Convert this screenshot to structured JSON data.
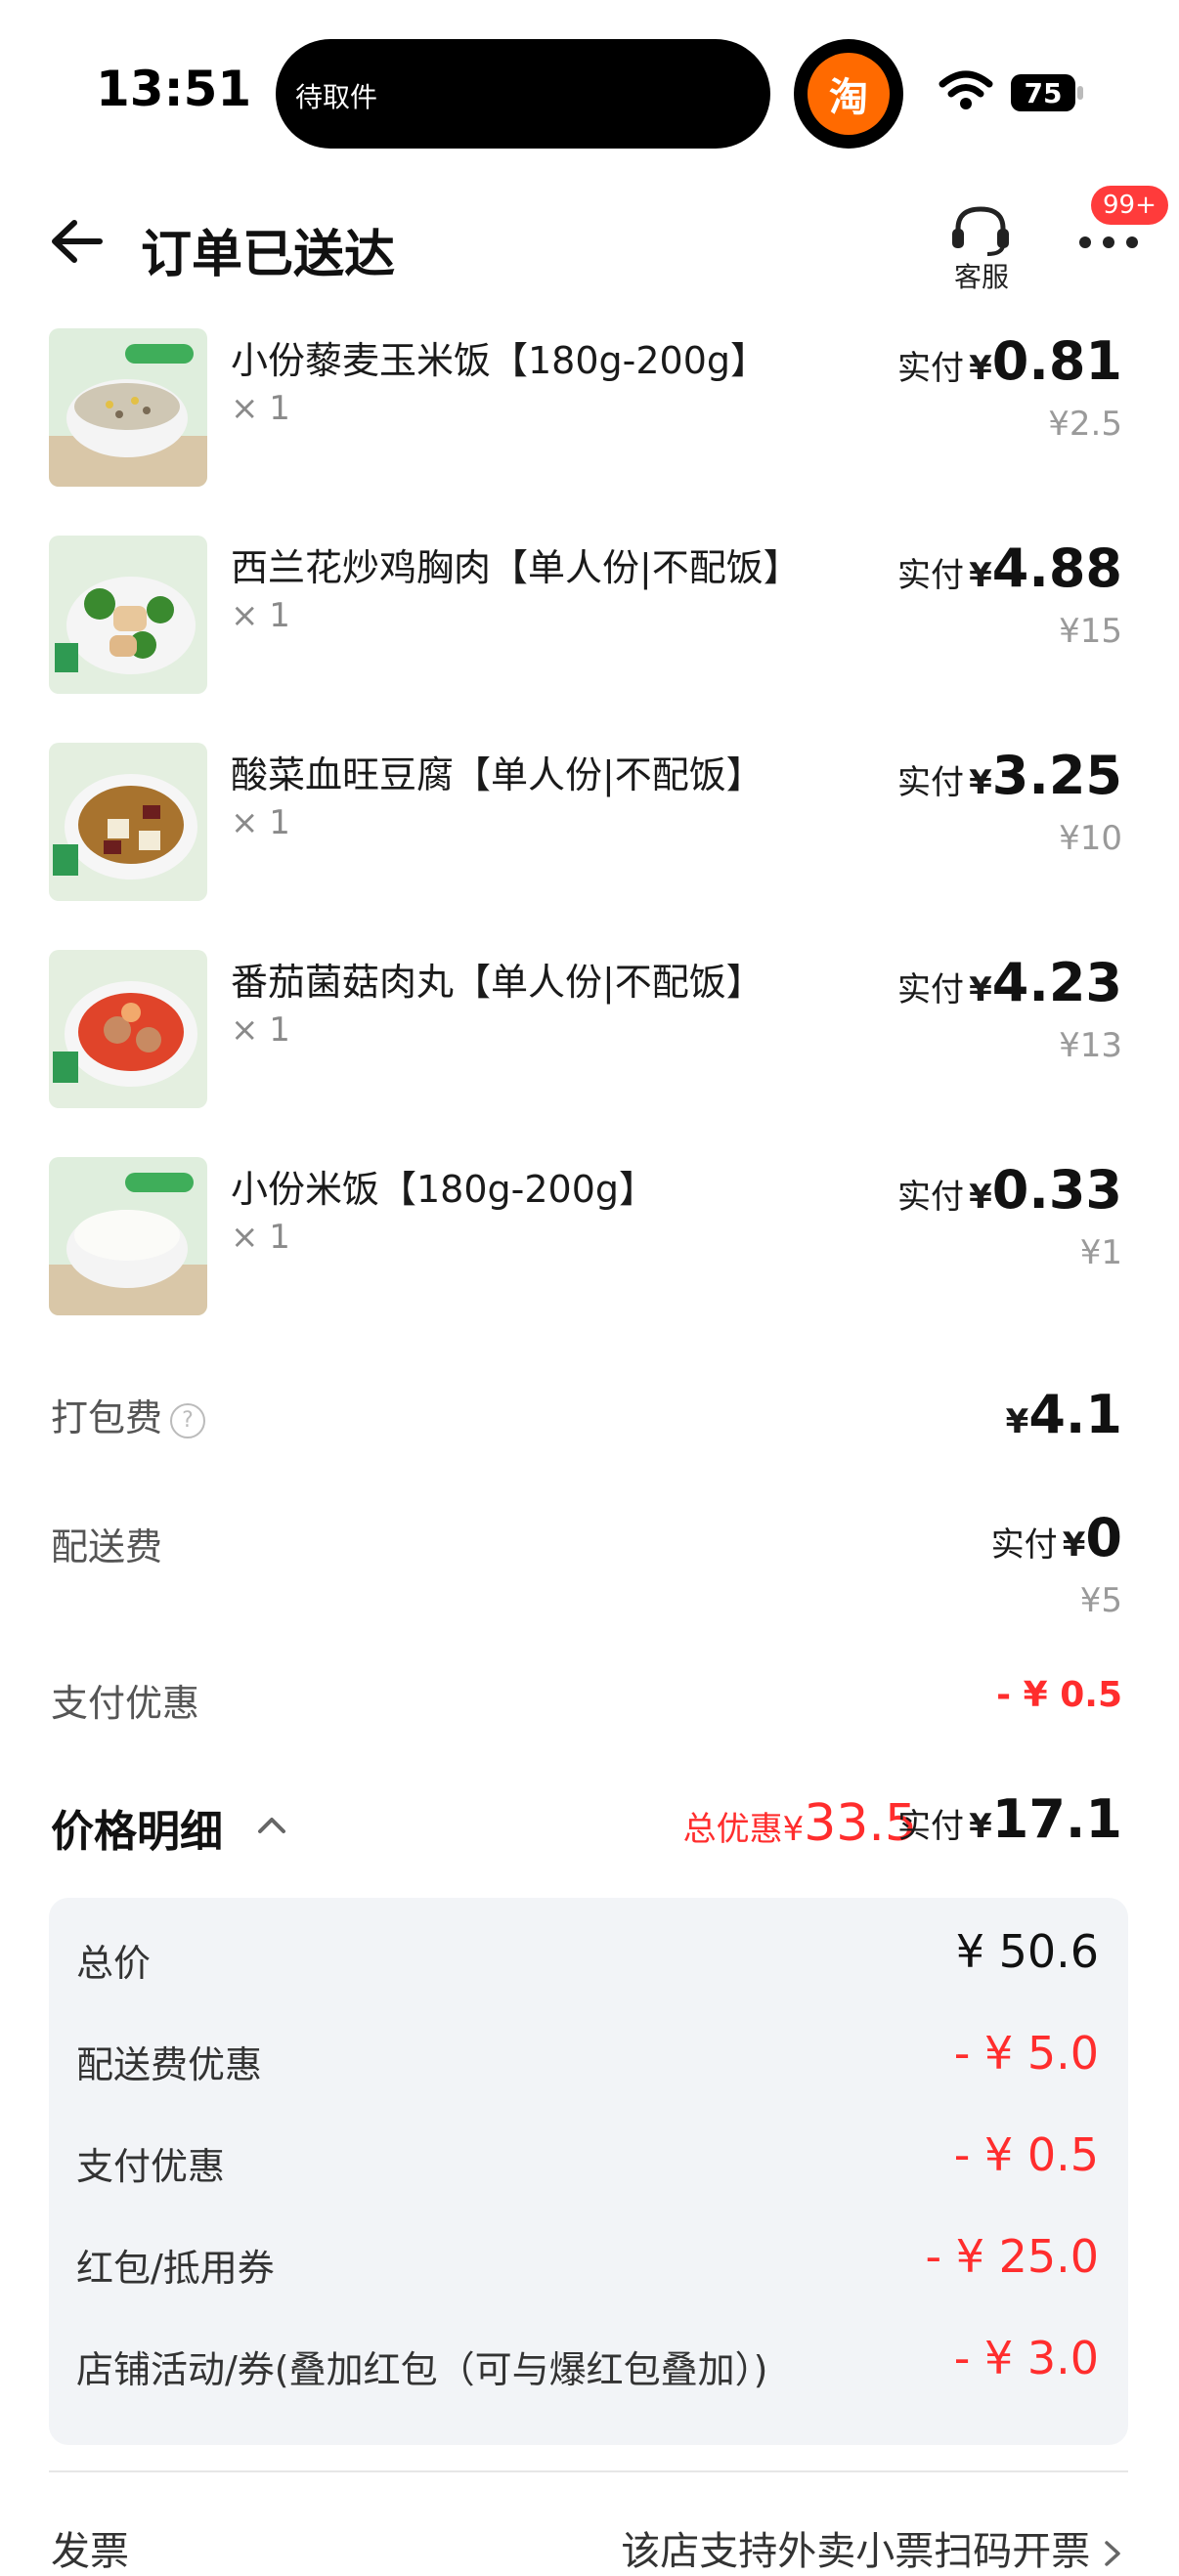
{
  "status_bar": {
    "time": "13:51",
    "island_text": "待取件",
    "app_icon_char": "淘",
    "battery": "75"
  },
  "header": {
    "title": "订单已送达",
    "service_label": "客服",
    "badge": "99+"
  },
  "items": [
    {
      "name": "小份藜麦玉米饭【180g-200g】",
      "qty": "× 1",
      "paid_label": "实付",
      "currency": "¥",
      "paid": "0.81",
      "original": "¥2.5",
      "thumb": "rice-grain"
    },
    {
      "name": "西兰花炒鸡胸肉【单人份|不配饭】",
      "qty": "× 1",
      "paid_label": "实付",
      "currency": "¥",
      "paid": "4.88",
      "original": "¥15",
      "thumb": "broccoli-chicken"
    },
    {
      "name": "酸菜血旺豆腐【单人份|不配饭】",
      "qty": "× 1",
      "paid_label": "实付",
      "currency": "¥",
      "paid": "3.25",
      "original": "¥10",
      "thumb": "tofu-soup"
    },
    {
      "name": "番茄菌菇肉丸【单人份|不配饭】",
      "qty": "× 1",
      "paid_label": "实付",
      "currency": "¥",
      "paid": "4.23",
      "original": "¥13",
      "thumb": "tomato-meatball"
    },
    {
      "name": "小份米饭【180g-200g】",
      "qty": "× 1",
      "paid_label": "实付",
      "currency": "¥",
      "paid": "0.33",
      "original": "¥1",
      "thumb": "white-rice"
    }
  ],
  "fees": {
    "packing_label": "打包费",
    "packing_help": "?",
    "packing_currency": "¥",
    "packing_value": "4.1",
    "delivery_label": "配送费",
    "delivery_paid_label": "实付",
    "delivery_currency": "¥",
    "delivery_value": "0",
    "delivery_original": "¥5",
    "pay_discount_label": "支付优惠",
    "pay_discount_value": "- ¥ 0.5"
  },
  "price_detail": {
    "title": "价格明细",
    "total_discount_label": "总优惠",
    "total_discount_currency": "¥",
    "total_discount_value": "33.5",
    "paid_label": "实付",
    "paid_currency": "¥",
    "paid_value": "17.1",
    "rows": [
      {
        "label": "总价",
        "value": "¥ 50.6",
        "color": "#111111"
      },
      {
        "label": "配送费优惠",
        "value": "- ¥ 5.0",
        "color": "#ff2d2d"
      },
      {
        "label": "支付优惠",
        "value": "- ¥ 0.5",
        "color": "#ff2d2d"
      },
      {
        "label": "红包/抵用券",
        "value": "- ¥ 25.0",
        "color": "#ff2d2d"
      },
      {
        "label": "店铺活动/券(叠加红包（可与爆红包叠加）)",
        "value": "- ¥ 3.0",
        "color": "#ff2d2d"
      }
    ]
  },
  "invoice": {
    "label": "发票",
    "value": "该店支持外卖小票扫码开票"
  },
  "colors": {
    "accent_red": "#ff2d2d",
    "panel_bg": "#f2f4f7",
    "taobao_orange": "#ff6a00"
  }
}
